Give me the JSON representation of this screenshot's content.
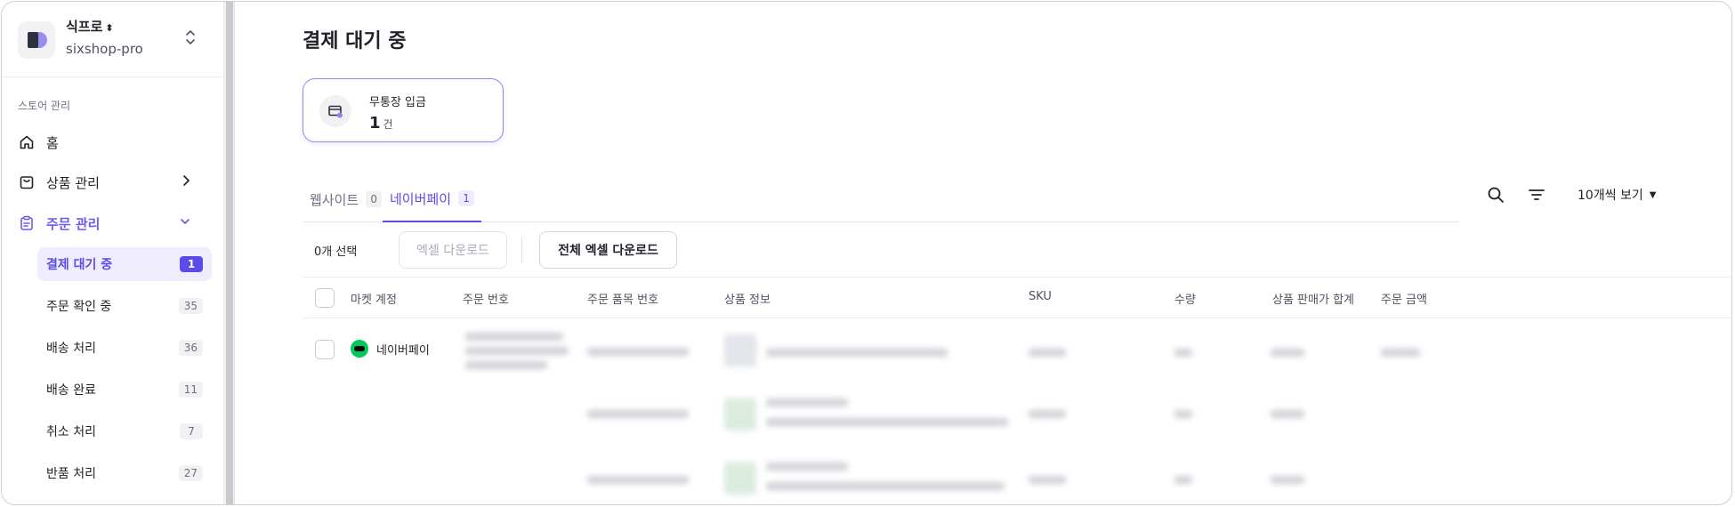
{
  "sidebar": {
    "store_name": "식프로",
    "store_switch_glyph": "⬍",
    "store_id": "sixshop-pro",
    "section_label": "스토어 관리",
    "nav": {
      "home": "홈",
      "products": "상품 관리",
      "orders": "주문 관리"
    },
    "order_items": [
      {
        "label": "결제 대기 중",
        "count": "1"
      },
      {
        "label": "주문 확인 중",
        "count": "35"
      },
      {
        "label": "배송 처리",
        "count": "36"
      },
      {
        "label": "배송 완료",
        "count": "11"
      },
      {
        "label": "취소 처리",
        "count": "7"
      },
      {
        "label": "반품 처리",
        "count": "27"
      }
    ]
  },
  "main": {
    "title": "결제 대기 중",
    "summary": {
      "label": "무통장 입금",
      "value": "1",
      "unit": "건"
    },
    "tabs": [
      {
        "label": "웹사이트",
        "count": "0"
      },
      {
        "label": "네이버페이",
        "count": "1"
      }
    ],
    "view_select": "10개씩 보기",
    "action_bar": {
      "selected": "0개 선택",
      "excel_download": "엑셀 다운로드",
      "all_excel_download": "전체 엑셀 다운로드"
    },
    "columns": [
      "마켓 계정",
      "주문 번호",
      "주문 품목 번호",
      "상품 정보",
      "SKU",
      "수량",
      "상품 판매가 합계",
      "주문 금액"
    ],
    "rows": [
      {
        "market": "네이버페이"
      }
    ]
  },
  "colors": {
    "accent": "#5b4be8",
    "naver": "#03c75a"
  },
  "icons": [
    "store-logo-icon",
    "unfold-icon",
    "home-icon",
    "shopping-bag-icon",
    "clipboard-icon",
    "chevron-right-icon",
    "chevron-down-icon",
    "bank-transfer-icon",
    "search-icon",
    "filter-icon",
    "caret-down-icon",
    "naver-pay-icon"
  ]
}
